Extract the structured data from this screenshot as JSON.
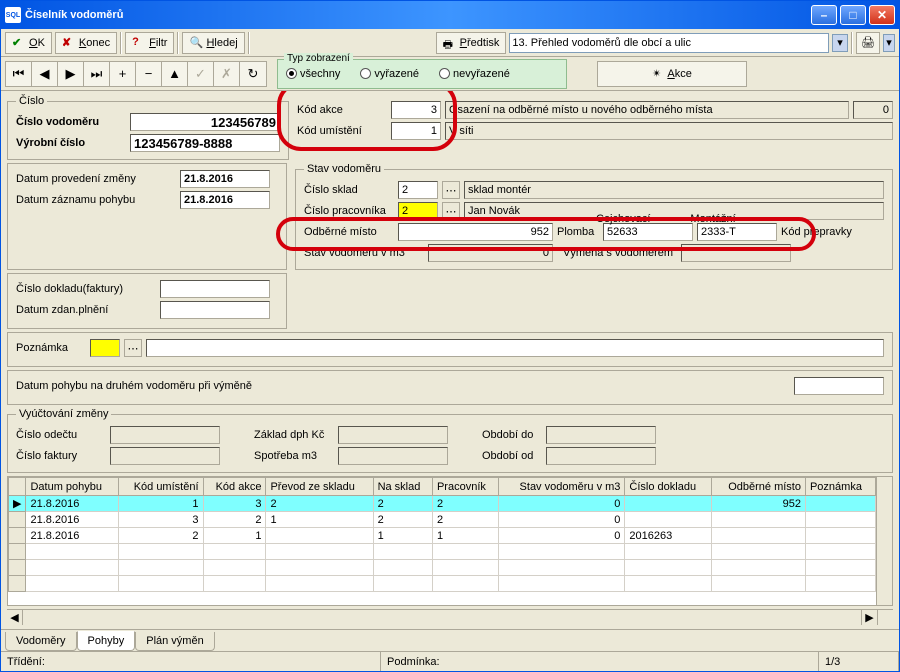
{
  "title": "Číselník vodoměrů",
  "toolbar": {
    "ok": "OK",
    "konec": "Konec",
    "filtr": "Filtr",
    "hledej": "Hledej",
    "predtisk": "Předtisk",
    "report_selected": "13. Přehled vodoměrů dle obcí a ulic"
  },
  "typ_zobrazeni": {
    "legend": "Typ zobrazení",
    "opts": [
      "všechny",
      "vyřazené",
      "nevyřazené"
    ],
    "selected": 0
  },
  "akce_btn": "Akce",
  "cislo": {
    "legend": "Číslo",
    "lbl_cv": "Číslo vodoměru",
    "cv": "123456789",
    "lbl_vc": "Výrobní číslo",
    "vc": "123456789-8888"
  },
  "kody": {
    "lbl_ka": "Kód akce",
    "ka": "3",
    "lbl_ku": "Kód umístění",
    "ku": "1",
    "osazeni": "Osazení na odběrné místo u nového odběrného místa",
    "osazeni_v": "0",
    "vsiti": "V síti"
  },
  "datumy": {
    "lbl_dpz": "Datum provedení změny",
    "dpz": "21.8.2016",
    "lbl_dzp": "Datum záznamu pohybu",
    "dzp": "21.8.2016"
  },
  "stav": {
    "legend": "Stav vodoměru",
    "lbl_csk": "Číslo sklad",
    "csk": "2",
    "sklad_monter": "sklad montér",
    "lbl_cpr": "Číslo pracovníka",
    "cpr": "2",
    "prac_name": "Jan Novák",
    "lbl_om": "Odběrné místo",
    "om": "952",
    "plomba_lbl": "Plomba",
    "cejch_lbl": "Cejchovací",
    "mont_lbl": "Montážní",
    "plomba1": "52633",
    "plomba2": "2333-T",
    "kod_prep": "Kód přepravky",
    "lbl_stm3": "Stav vodoměru v m3",
    "stm3": "0",
    "vymena": "Výměna s vodoměrem"
  },
  "doklad": {
    "lbl_cdf": "Číslo dokladu(faktury)",
    "cdf": "",
    "lbl_dzp": "Datum zdan.plnění",
    "dzp": ""
  },
  "poznamka": {
    "lbl": "Poznámka",
    "val": ""
  },
  "datum_pohybu_druhy": "Datum pohybu na druhém vodoměru při výměně",
  "vyuct": {
    "legend": "Vyúčtování změny",
    "lbl_co": "Číslo odečtu",
    "lbl_cf": "Číslo faktury",
    "lbl_zd": "Základ dph Kč",
    "lbl_sm": "Spotřeba m3",
    "lbl_odo": "Období do",
    "lbl_ood": "Období od"
  },
  "grid": {
    "headers": [
      "Datum pohybu",
      "Kód umístění",
      "Kód akce",
      "Převod ze skladu",
      "Na sklad",
      "Pracovník",
      "Stav vodoměru v m3",
      "Číslo dokladu",
      "Odběrné místo",
      "Poznámka"
    ],
    "rows": [
      {
        "sel": true,
        "c": [
          "21.8.2016",
          "1",
          "3",
          "2",
          "2",
          "2",
          "0",
          "",
          "952",
          ""
        ]
      },
      {
        "sel": false,
        "c": [
          "21.8.2016",
          "3",
          "2",
          "1",
          "2",
          "2",
          "0",
          "",
          "",
          ""
        ]
      },
      {
        "sel": false,
        "c": [
          "21.8.2016",
          "2",
          "1",
          "",
          "1",
          "1",
          "0",
          "2016263",
          "",
          ""
        ]
      }
    ]
  },
  "tabs": [
    "Vodoměry",
    "Pohyby",
    "Plán výměn"
  ],
  "active_tab": 1,
  "status": {
    "trideni": "Třídění:",
    "podminka": "Podmínka:",
    "pager": "1/3"
  }
}
